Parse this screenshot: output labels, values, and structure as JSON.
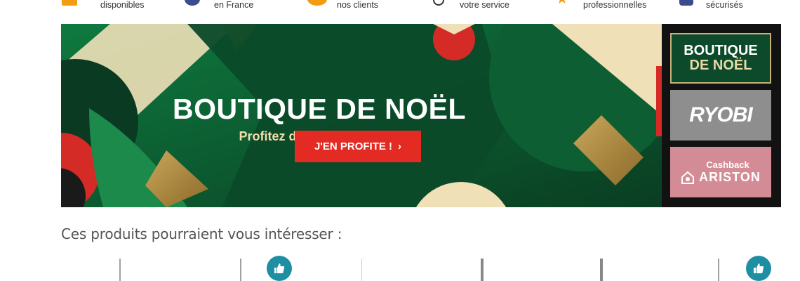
{
  "strip": {
    "items": [
      {
        "label": "disponibles",
        "icon": "stock-icon",
        "color": "#f39c12"
      },
      {
        "label": "en France",
        "icon": "france-flag-icon",
        "color": "#3d4a8c"
      },
      {
        "label": "nos clients",
        "icon": "chat-icon",
        "color": "#f39c12"
      },
      {
        "label": "votre service",
        "icon": "headset-icon",
        "color": "#333333"
      },
      {
        "label": "professionnelles",
        "icon": "star-icon",
        "color": "#f39c12"
      },
      {
        "label": "sécurisés",
        "icon": "lock-icon",
        "color": "#3d4a8c"
      }
    ]
  },
  "hero": {
    "title": "BOUTIQUE DE NOËL",
    "subtitle": "Profitez de nos bons plans",
    "cta_label": "J'EN PROFITE !",
    "cta_color": "#e32a23"
  },
  "side_tiles": {
    "noel": {
      "line1": "BOUTIQUE",
      "line2": "DE NOËL"
    },
    "ryobi": {
      "label": "RYOBI"
    },
    "ariston": {
      "line1": "Cashback",
      "line2": "ARISTON"
    }
  },
  "suggestions": {
    "title": "Ces produits pourraient vous intéresser :"
  }
}
